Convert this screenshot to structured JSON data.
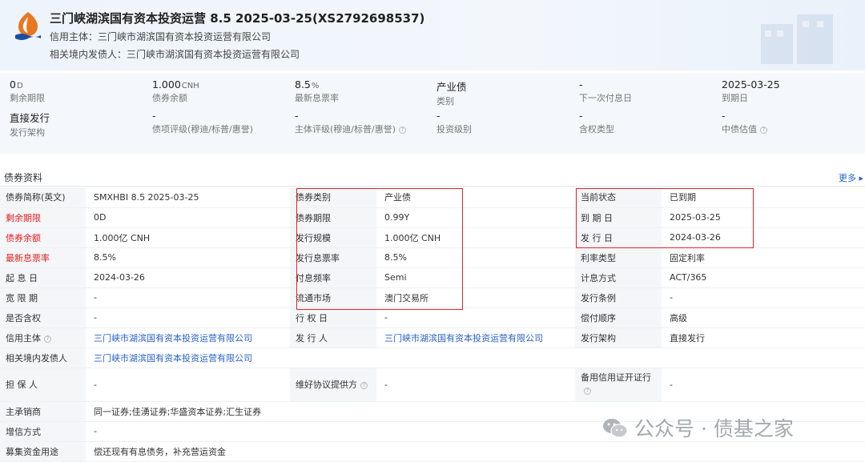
{
  "header": {
    "title": "三门峡湖滨国有资本投资运营 8.5 2025-03-25(XS2792698537)",
    "credit_subject_line": "信用主体：三门峡市湖滨国有资本投资运营有限公司",
    "related_issuer_line": "相关境内发债人：三门峡市湖滨国有资本投资运营有限公司"
  },
  "summary": {
    "row1": [
      {
        "value": "0",
        "unit": "D",
        "label": "剩余期限"
      },
      {
        "value": "1.000",
        "unit": "CNH",
        "label": "债券余额"
      },
      {
        "value": "8.5",
        "unit": "%",
        "label": "最新息票率"
      },
      {
        "value": "产业债",
        "unit": "",
        "label": "类别"
      },
      {
        "value": "-",
        "unit": "",
        "label": "下一次付息日"
      },
      {
        "value": "2025-03-25",
        "unit": "",
        "label": "到期日"
      }
    ],
    "row2": [
      {
        "value": "直接发行",
        "label": "发行架构"
      },
      {
        "value": "-",
        "label": "债项评级(穆迪/标普/惠誉)"
      },
      {
        "value": "-",
        "label": "主体评级(穆迪/标普/惠誉)"
      },
      {
        "value": "-",
        "label": "投资级别"
      },
      {
        "value": "-",
        "label": "含权类型"
      },
      {
        "value": "-",
        "label": "中债估值"
      }
    ]
  },
  "section": {
    "title": "债券资料",
    "more_label": "更多"
  },
  "table": {
    "rows": [
      [
        "债券简称(英文)",
        "SMXHBI 8.5 2025-03-25",
        "债券类别",
        "产业债",
        "当前状态",
        "已到期"
      ],
      [
        "剩余期限",
        "0D",
        "债券期限",
        "0.99Y",
        "到 期 日",
        "2025-03-25"
      ],
      [
        "债券余额",
        "1.000亿 CNH",
        "发行规模",
        "1.000亿 CNH",
        "发 行 日",
        "2024-03-26"
      ],
      [
        "最新息票率",
        "8.5%",
        "发行息票率",
        "8.5%",
        "利率类型",
        "固定利率"
      ],
      [
        "起 息 日",
        "2024-03-26",
        "付息频率",
        "Semi",
        "计息方式",
        "ACT/365"
      ],
      [
        "宽 限 期",
        "-",
        "流通市场",
        "澳门交易所",
        "发行条例",
        "-"
      ],
      [
        "是否含权",
        "-",
        "行 权 日",
        "-",
        "偿付顺序",
        "高级"
      ],
      [
        "信用主体",
        "三门峡市湖滨国有资本投资运营有限公司",
        "发 行 人",
        "三门峡市湖滨国有资本投资运营有限公司",
        "发行架构",
        "直接发行"
      ],
      [
        "相关境内发债人",
        "三门峡市湖滨国有资本投资运营有限公司",
        "",
        "",
        "",
        ""
      ],
      [
        "担 保 人",
        "-",
        "维好协议提供方",
        "-",
        "备用信用证开证行",
        "-"
      ],
      [
        "主承销商",
        "同一证券;佳湧证券;华盛资本证券;汇生证券",
        "",
        "",
        "",
        ""
      ],
      [
        "增信方式",
        "-",
        "",
        "",
        "",
        ""
      ],
      [
        "募集资金用途",
        "偿还现有有息债务，补充营运资金",
        "",
        "",
        "",
        ""
      ]
    ]
  },
  "watermark": {
    "text": "公众号 · 债基之家"
  },
  "colors": {
    "link": "#2a62c9",
    "highlight_label": "#e02020",
    "annotation_box": "#e0262a"
  }
}
